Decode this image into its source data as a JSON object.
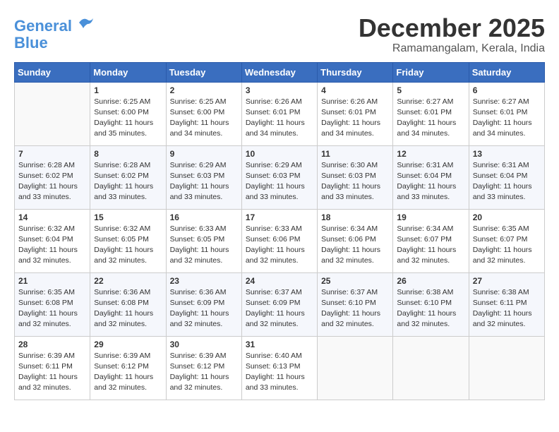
{
  "header": {
    "logo_line1": "General",
    "logo_line2": "Blue",
    "month": "December 2025",
    "location": "Ramamangalam, Kerala, India"
  },
  "weekdays": [
    "Sunday",
    "Monday",
    "Tuesday",
    "Wednesday",
    "Thursday",
    "Friday",
    "Saturday"
  ],
  "weeks": [
    [
      {
        "day": null
      },
      {
        "day": 1,
        "sunrise": "6:25 AM",
        "sunset": "6:00 PM",
        "daylight": "11 hours and 35 minutes."
      },
      {
        "day": 2,
        "sunrise": "6:25 AM",
        "sunset": "6:00 PM",
        "daylight": "11 hours and 34 minutes."
      },
      {
        "day": 3,
        "sunrise": "6:26 AM",
        "sunset": "6:01 PM",
        "daylight": "11 hours and 34 minutes."
      },
      {
        "day": 4,
        "sunrise": "6:26 AM",
        "sunset": "6:01 PM",
        "daylight": "11 hours and 34 minutes."
      },
      {
        "day": 5,
        "sunrise": "6:27 AM",
        "sunset": "6:01 PM",
        "daylight": "11 hours and 34 minutes."
      },
      {
        "day": 6,
        "sunrise": "6:27 AM",
        "sunset": "6:01 PM",
        "daylight": "11 hours and 34 minutes."
      }
    ],
    [
      {
        "day": 7,
        "sunrise": "6:28 AM",
        "sunset": "6:02 PM",
        "daylight": "11 hours and 33 minutes."
      },
      {
        "day": 8,
        "sunrise": "6:28 AM",
        "sunset": "6:02 PM",
        "daylight": "11 hours and 33 minutes."
      },
      {
        "day": 9,
        "sunrise": "6:29 AM",
        "sunset": "6:03 PM",
        "daylight": "11 hours and 33 minutes."
      },
      {
        "day": 10,
        "sunrise": "6:29 AM",
        "sunset": "6:03 PM",
        "daylight": "11 hours and 33 minutes."
      },
      {
        "day": 11,
        "sunrise": "6:30 AM",
        "sunset": "6:03 PM",
        "daylight": "11 hours and 33 minutes."
      },
      {
        "day": 12,
        "sunrise": "6:31 AM",
        "sunset": "6:04 PM",
        "daylight": "11 hours and 33 minutes."
      },
      {
        "day": 13,
        "sunrise": "6:31 AM",
        "sunset": "6:04 PM",
        "daylight": "11 hours and 33 minutes."
      }
    ],
    [
      {
        "day": 14,
        "sunrise": "6:32 AM",
        "sunset": "6:04 PM",
        "daylight": "11 hours and 32 minutes."
      },
      {
        "day": 15,
        "sunrise": "6:32 AM",
        "sunset": "6:05 PM",
        "daylight": "11 hours and 32 minutes."
      },
      {
        "day": 16,
        "sunrise": "6:33 AM",
        "sunset": "6:05 PM",
        "daylight": "11 hours and 32 minutes."
      },
      {
        "day": 17,
        "sunrise": "6:33 AM",
        "sunset": "6:06 PM",
        "daylight": "11 hours and 32 minutes."
      },
      {
        "day": 18,
        "sunrise": "6:34 AM",
        "sunset": "6:06 PM",
        "daylight": "11 hours and 32 minutes."
      },
      {
        "day": 19,
        "sunrise": "6:34 AM",
        "sunset": "6:07 PM",
        "daylight": "11 hours and 32 minutes."
      },
      {
        "day": 20,
        "sunrise": "6:35 AM",
        "sunset": "6:07 PM",
        "daylight": "11 hours and 32 minutes."
      }
    ],
    [
      {
        "day": 21,
        "sunrise": "6:35 AM",
        "sunset": "6:08 PM",
        "daylight": "11 hours and 32 minutes."
      },
      {
        "day": 22,
        "sunrise": "6:36 AM",
        "sunset": "6:08 PM",
        "daylight": "11 hours and 32 minutes."
      },
      {
        "day": 23,
        "sunrise": "6:36 AM",
        "sunset": "6:09 PM",
        "daylight": "11 hours and 32 minutes."
      },
      {
        "day": 24,
        "sunrise": "6:37 AM",
        "sunset": "6:09 PM",
        "daylight": "11 hours and 32 minutes."
      },
      {
        "day": 25,
        "sunrise": "6:37 AM",
        "sunset": "6:10 PM",
        "daylight": "11 hours and 32 minutes."
      },
      {
        "day": 26,
        "sunrise": "6:38 AM",
        "sunset": "6:10 PM",
        "daylight": "11 hours and 32 minutes."
      },
      {
        "day": 27,
        "sunrise": "6:38 AM",
        "sunset": "6:11 PM",
        "daylight": "11 hours and 32 minutes."
      }
    ],
    [
      {
        "day": 28,
        "sunrise": "6:39 AM",
        "sunset": "6:11 PM",
        "daylight": "11 hours and 32 minutes."
      },
      {
        "day": 29,
        "sunrise": "6:39 AM",
        "sunset": "6:12 PM",
        "daylight": "11 hours and 32 minutes."
      },
      {
        "day": 30,
        "sunrise": "6:39 AM",
        "sunset": "6:12 PM",
        "daylight": "11 hours and 32 minutes."
      },
      {
        "day": 31,
        "sunrise": "6:40 AM",
        "sunset": "6:13 PM",
        "daylight": "11 hours and 33 minutes."
      },
      {
        "day": null
      },
      {
        "day": null
      },
      {
        "day": null
      }
    ]
  ]
}
